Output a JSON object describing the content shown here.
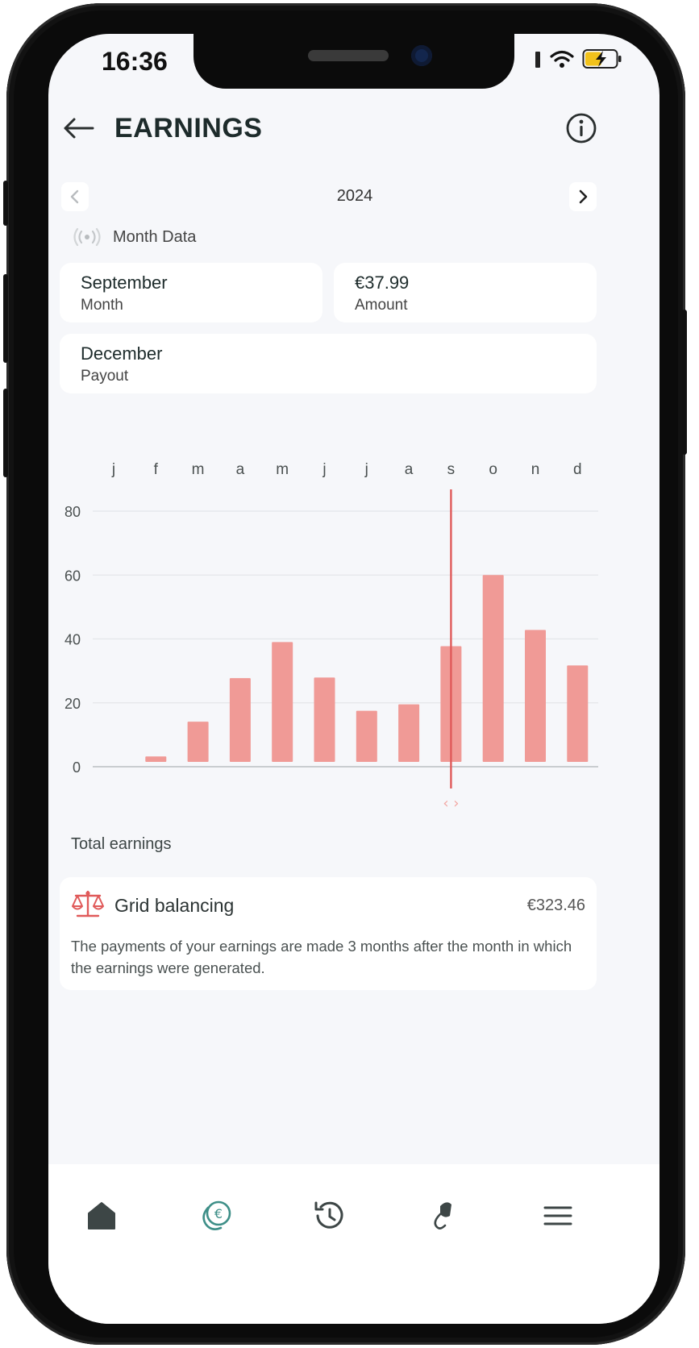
{
  "status_bar": {
    "time": "16:36"
  },
  "header": {
    "title": "EARNINGS"
  },
  "year_nav": {
    "year": "2024"
  },
  "month_data": {
    "label": "Month Data"
  },
  "cards": {
    "month": {
      "value": "September",
      "label": "Month"
    },
    "amount": {
      "value": "€37.99",
      "label": "Amount"
    },
    "payout": {
      "value": "December",
      "label": "Payout"
    }
  },
  "chart_data": {
    "type": "bar",
    "categories": [
      "j",
      "f",
      "m",
      "a",
      "m",
      "j",
      "j",
      "a",
      "s",
      "o",
      "n",
      "d"
    ],
    "values": [
      0,
      1.7,
      12.6,
      26.2,
      37.5,
      26.4,
      16,
      18,
      36.2,
      58.5,
      41.3,
      30.2
    ],
    "yticks": [
      0,
      20,
      40,
      60,
      80
    ],
    "ylim": [
      0,
      80
    ],
    "selected_index": 8,
    "bar_color": "#f09a96",
    "selection_color": "#e05a5a",
    "grid": true
  },
  "total": {
    "label": "Total earnings",
    "item": {
      "title": "Grid balancing",
      "amount": "€323.46",
      "description": "The payments of your earnings are made 3 months after the month in which the earnings were generated."
    }
  },
  "bottom_nav": {
    "items": [
      "home-icon",
      "euro-coins-icon",
      "history-icon",
      "charger-plug-icon",
      "menu-icon"
    ],
    "active_index": 1,
    "active_color": "#3e8f88"
  }
}
